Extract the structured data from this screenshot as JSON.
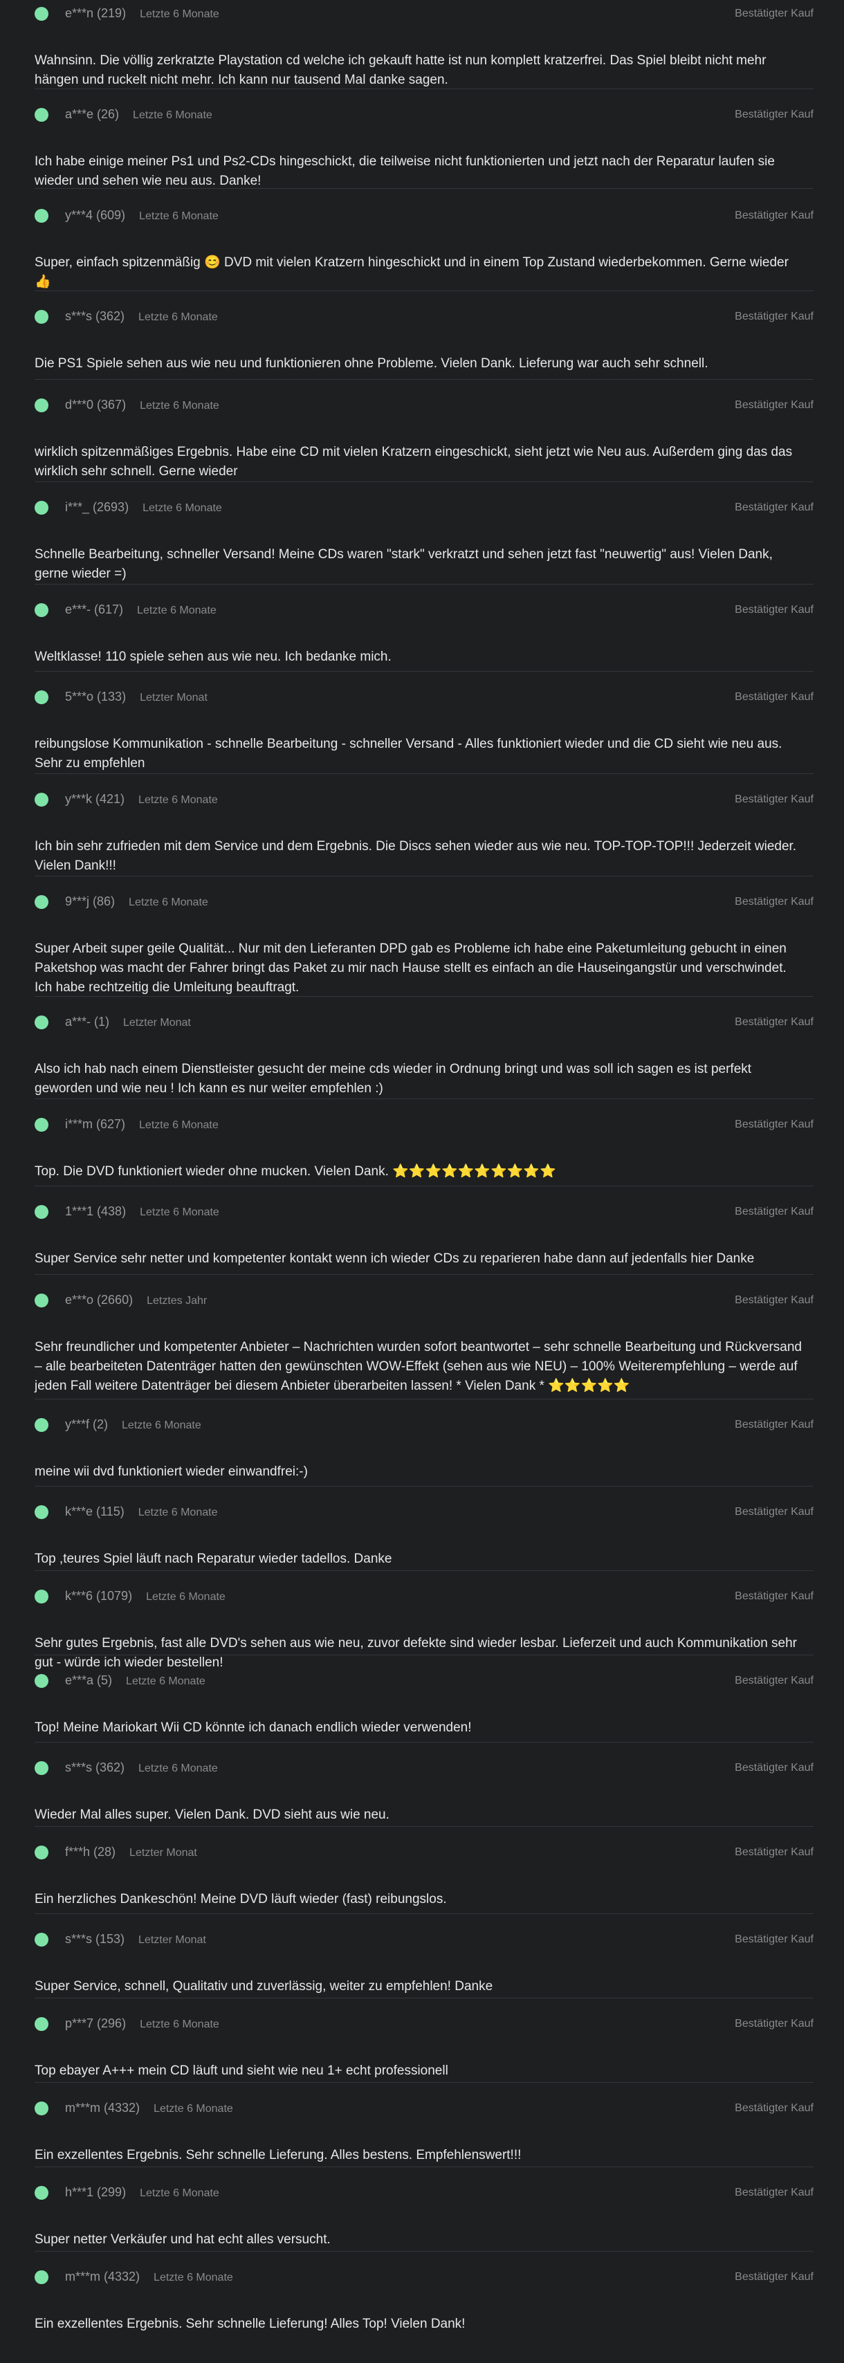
{
  "verified_label": "Bestätigter Kauf",
  "reviews": [
    {
      "user": "e***n (219)",
      "time": "Letzte 6 Monate",
      "text": "Wahnsinn. Die völlig zerkratzte Playstation cd welche ich gekauft hatte ist nun komplett kratzerfrei. Das Spiel bleibt nicht mehr hängen und ruckelt nicht mehr. Ich kann nur tausend Mal danke sagen."
    },
    {
      "user": "a***e (26)",
      "time": "Letzte 6 Monate",
      "text": "Ich habe einige meiner Ps1 und Ps2-CDs hingeschickt, die teilweise nicht funktionierten und jetzt nach der Reparatur laufen sie wieder und sehen wie neu aus. Danke!"
    },
    {
      "user": "y***4 (609)",
      "time": "Letzte 6 Monate",
      "text": "Super, einfach spitzenmäßig 😊 DVD mit vielen Kratzern hingeschickt und in einem Top Zustand wiederbekommen. Gerne wieder 👍"
    },
    {
      "user": "s***s (362)",
      "time": "Letzte 6 Monate",
      "text": "Die PS1 Spiele sehen aus wie neu und funktionieren ohne Probleme. Vielen Dank. Lieferung war auch sehr schnell."
    },
    {
      "user": "d***0 (367)",
      "time": "Letzte 6 Monate",
      "text": "wirklich spitzenmäßiges Ergebnis. Habe eine CD mit vielen Kratzern eingeschickt, sieht jetzt wie Neu aus. Außerdem ging das das wirklich sehr schnell. Gerne wieder"
    },
    {
      "user": "i***_ (2693)",
      "time": "Letzte 6 Monate",
      "text": "Schnelle Bearbeitung, schneller Versand! Meine CDs waren \"stark\" verkratzt und sehen jetzt fast \"neuwertig\" aus! Vielen Dank, gerne wieder =)"
    },
    {
      "user": "e***- (617)",
      "time": "Letzte 6 Monate",
      "text": "Weltklasse! 110 spiele sehen aus wie neu. Ich bedanke mich."
    },
    {
      "user": "5***o (133)",
      "time": "Letzter Monat",
      "text": "reibungslose Kommunikation - schnelle Bearbeitung - schneller Versand - Alles funktioniert wieder und die CD sieht wie neu aus. Sehr zu empfehlen"
    },
    {
      "user": "y***k (421)",
      "time": "Letzte 6 Monate",
      "text": "Ich bin sehr zufrieden mit dem Service und dem Ergebnis. Die Discs sehen wieder aus wie neu. TOP-TOP-TOP!!! Jederzeit wieder. Vielen Dank!!!"
    },
    {
      "user": "9***j (86)",
      "time": "Letzte 6 Monate",
      "text": "Super Arbeit super geile Qualität... Nur mit den Lieferanten DPD gab es Probleme ich habe eine Paketumleitung gebucht in einen Paketshop was macht der Fahrer bringt das Paket zu mir nach Hause stellt es einfach an die Hauseingangstür und verschwindet. Ich habe rechtzeitig die Umleitung beauftragt."
    },
    {
      "user": "a***- (1)",
      "time": "Letzter Monat",
      "text": "Also ich hab nach einem Dienstleister gesucht der meine cds wieder in Ordnung bringt und was soll ich sagen es ist perfekt geworden und wie neu ! Ich kann es nur weiter empfehlen :)"
    },
    {
      "user": "i***m (627)",
      "time": "Letzte 6 Monate",
      "text": "Top. Die DVD funktioniert wieder ohne mucken. Vielen Dank. ⭐⭐⭐⭐⭐⭐⭐⭐⭐⭐"
    },
    {
      "user": "1***1 (438)",
      "time": "Letzte 6 Monate",
      "text": "Super Service sehr netter und kompetenter kontakt wenn ich wieder CDs zu reparieren habe dann auf jedenfalls hier Danke"
    },
    {
      "user": "e***o (2660)",
      "time": "Letztes Jahr",
      "text": "Sehr freundlicher und kompetenter Anbieter – Nachrichten wurden sofort beantwortet – sehr schnelle Bearbeitung und Rückversand – alle bearbeiteten Datenträger hatten den gewünschten WOW-Effekt (sehen aus wie NEU) – 100% Weiterempfehlung – werde auf jeden Fall weitere Datenträger bei diesem Anbieter überarbeiten lassen! * Vielen Dank * ⭐⭐⭐⭐⭐"
    },
    {
      "user": "y***f (2)",
      "time": "Letzte 6 Monate",
      "text": "meine wii dvd funktioniert wieder einwandfrei:-)"
    },
    {
      "user": "k***e (115)",
      "time": "Letzte 6 Monate",
      "text": "Top ,teures Spiel läuft nach Reparatur wieder tadellos. Danke"
    },
    {
      "user": "k***6 (1079)",
      "time": "Letzte 6 Monate",
      "text": "Sehr gutes Ergebnis, fast alle DVD's sehen aus wie neu, zuvor defekte sind wieder lesbar. Lieferzeit und auch Kommunikation sehr gut - würde ich wieder bestellen!"
    },
    {
      "user": "e***a (5)",
      "time": "Letzte 6 Monate",
      "text": "Top! Meine Mariokart Wii CD könnte ich danach endlich wieder verwenden!"
    },
    {
      "user": "s***s (362)",
      "time": "Letzte 6 Monate",
      "text": "Wieder Mal alles super. Vielen Dank. DVD sieht aus wie neu."
    },
    {
      "user": "f***h (28)",
      "time": "Letzter Monat",
      "text": "Ein herzliches Dankeschön! Meine DVD läuft wieder (fast) reibungslos."
    },
    {
      "user": "s***s (153)",
      "time": "Letzter Monat",
      "text": "Super Service, schnell, Qualitativ und zuverlässig, weiter zu empfehlen! Danke"
    },
    {
      "user": "p***7 (296)",
      "time": "Letzte 6 Monate",
      "text": "Top ebayer A+++ mein CD läuft und sieht wie neu 1+ echt professionell"
    },
    {
      "user": "m***m (4332)",
      "time": "Letzte 6 Monate",
      "text": "Ein exzellentes Ergebnis. Sehr schnelle Lieferung. Alles bestens. Empfehlenswert!!!"
    },
    {
      "user": "h***1 (299)",
      "time": "Letzte 6 Monate",
      "text": "Super netter Verkäufer und hat echt alles versucht."
    },
    {
      "user": "m***m (4332)",
      "time": "Letzte 6 Monate",
      "text": "Ein exzellentes Ergebnis. Sehr schnelle Lieferung! Alles Top! Vielen Dank!"
    }
  ]
}
